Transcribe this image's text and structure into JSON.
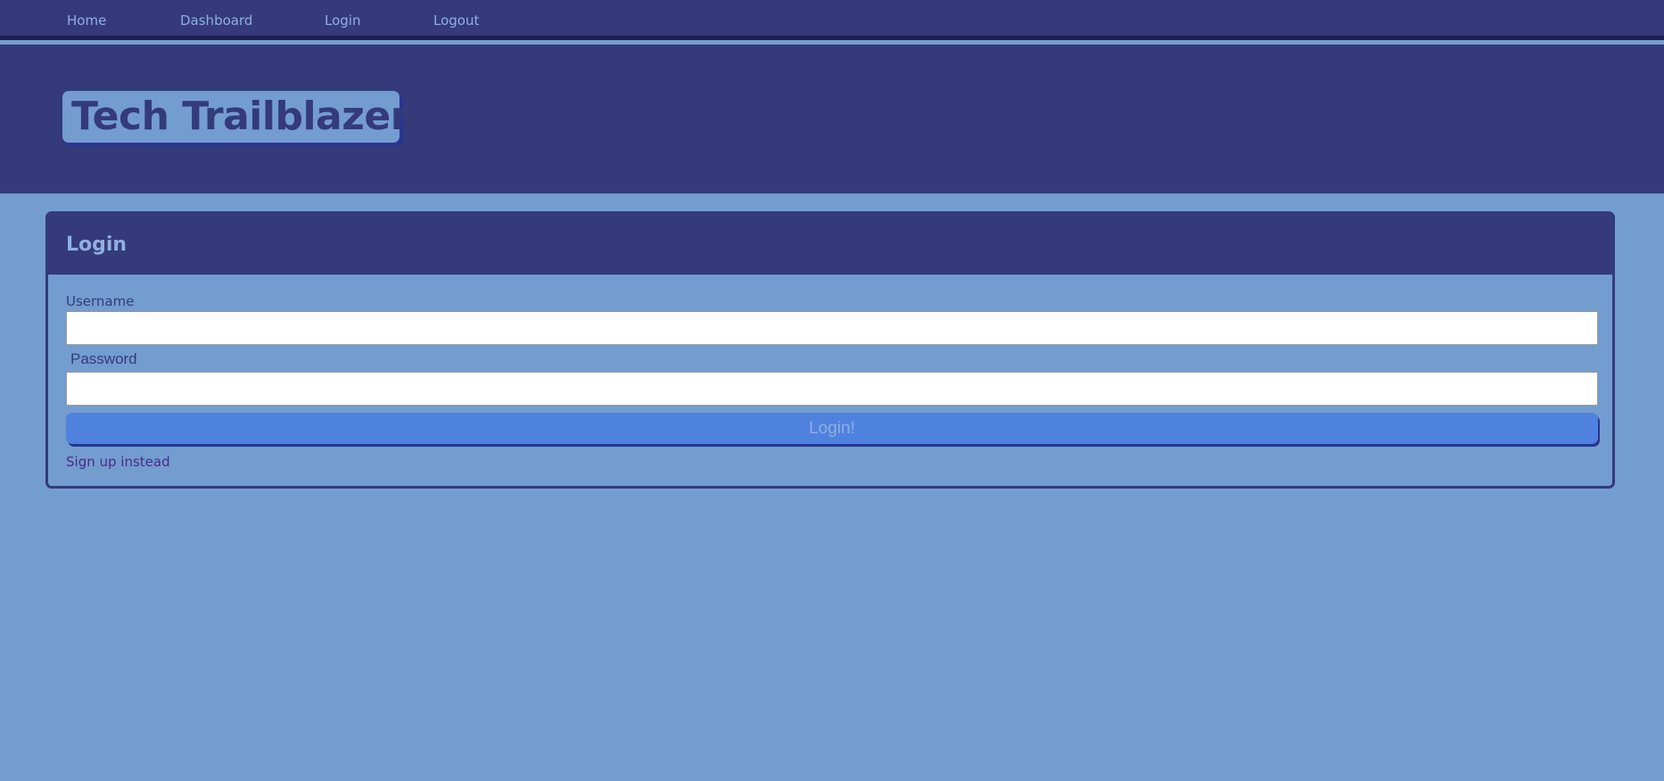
{
  "nav": {
    "items": [
      {
        "label": "Home"
      },
      {
        "label": "Dashboard"
      },
      {
        "label": "Login"
      },
      {
        "label": "Logout"
      }
    ]
  },
  "header": {
    "brand": "Tech Trailblazer"
  },
  "login_form": {
    "title": "Login",
    "username_label": "Username",
    "username_value": "",
    "password_label": "Password",
    "password_value": "",
    "submit_label": "Login!",
    "signup_link": "Sign up instead"
  },
  "colors": {
    "page_background": "#739dcf",
    "header_background": "#343a7a",
    "button_background": "#4f82de",
    "link_color": "#4a2a8a"
  }
}
